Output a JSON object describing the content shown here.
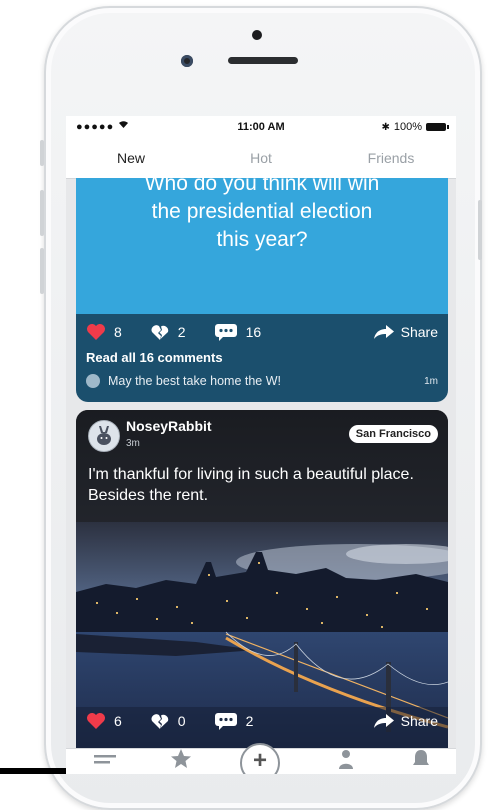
{
  "status_bar": {
    "signal": "●●●●● ",
    "time": "11:00 AM",
    "battery": "100%"
  },
  "tabs": [
    {
      "label": "New",
      "active": true
    },
    {
      "label": "Hot",
      "active": false
    },
    {
      "label": "Friends",
      "active": false
    }
  ],
  "post1": {
    "question_lines": [
      "Who do you think will win",
      "the presidential election",
      "this year?"
    ],
    "likes": "8",
    "dislikes": "2",
    "comments": "16",
    "share_label": "Share",
    "read_all": "Read all 16 comments",
    "top_comment": "May the best take home the W!",
    "top_comment_time": "1m",
    "background_color": "#35a6dc"
  },
  "post2": {
    "username": "NoseyRabbit",
    "time": "3m",
    "location": "San Francisco",
    "text": "I'm thankful for living in such a beautiful place. Besides the rent.",
    "likes": "6",
    "dislikes": "0",
    "comments": "2",
    "share_label": "Share"
  },
  "colors": {
    "like": "#ef3b4a",
    "card_footer": "#1b4f6d"
  }
}
